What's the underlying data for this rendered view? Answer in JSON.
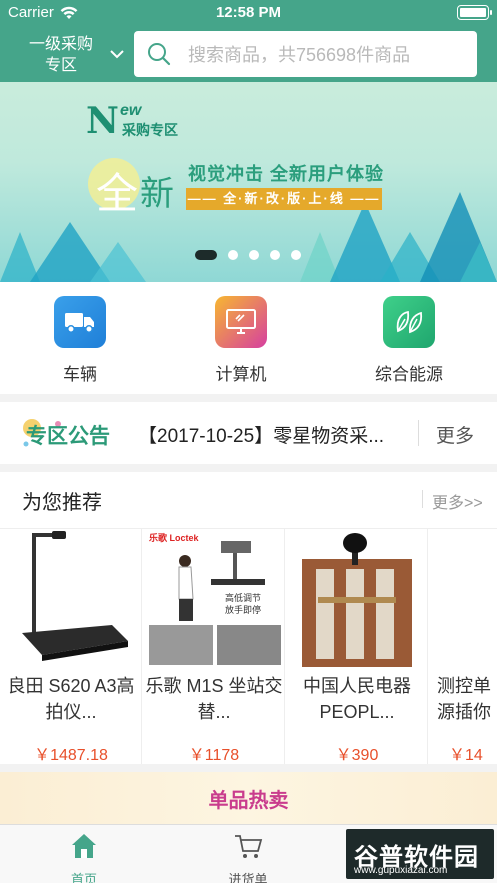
{
  "status_bar": {
    "carrier": "Carrier",
    "time": "12:58 PM",
    "battery_level": 1.0
  },
  "header": {
    "zone_label": "一级采购专区",
    "search_placeholder": "搜索商品，共756698件商品"
  },
  "banner": {
    "new_letter": "N",
    "new_sup": "ew",
    "new_sub": "采购专区",
    "big_1": "全",
    "big_2": "新",
    "tagline": "视觉冲击 全新用户体验",
    "strip": "—— 全·新·改·版·上·线 ——",
    "page_count": 5,
    "active_page": 0
  },
  "categories": [
    {
      "label": "车辆",
      "icon": "truck-icon",
      "color_from": "#3aa0ea",
      "color_to": "#1f7fd8"
    },
    {
      "label": "计算机",
      "icon": "computer-icon",
      "color_from": "#f7b731",
      "color_to": "#d63fa0"
    },
    {
      "label": "综合能源",
      "icon": "leaf-icon",
      "color_from": "#3fd08a",
      "color_to": "#1fa66e"
    }
  ],
  "notice": {
    "logo": "专区公告",
    "text": "【2017-10-25】零星物资采...",
    "more": "更多"
  },
  "recommend": {
    "title": "为您推荐",
    "more": "更多>>",
    "products": [
      {
        "name": "良田 S620 A3高拍仪...",
        "price": "￥1487.18"
      },
      {
        "name": "乐歌 M1S 坐站交替...",
        "price": "￥1178",
        "brand": "乐歌 Loctek",
        "caption_1": "高低调节",
        "caption_2": "放手即停"
      },
      {
        "name": "中国人民电器 PEOPL...",
        "price": "￥390"
      },
      {
        "name": "测控单 源插你",
        "price": "￥14"
      }
    ]
  },
  "hot": {
    "label": "单品热卖"
  },
  "tabbar": {
    "tabs": [
      {
        "label": "首页",
        "icon": "home-icon",
        "active": true
      },
      {
        "label": "进货单",
        "icon": "cart-icon",
        "active": false
      }
    ]
  },
  "watermark": {
    "text": "谷普软件园",
    "url": "www.gupuxiazai.com"
  },
  "colors": {
    "primary": "#45a58a",
    "price": "#e8502b",
    "hot": "#c93c8d"
  }
}
